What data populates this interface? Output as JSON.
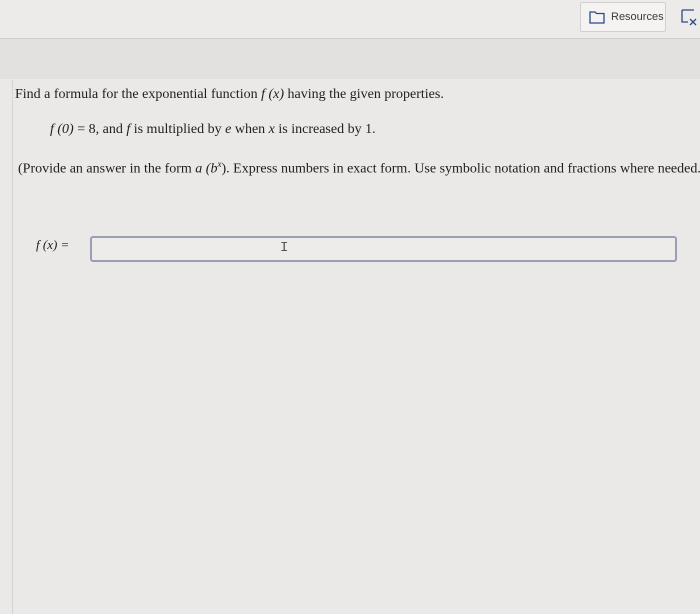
{
  "toolbar": {
    "resources_label": "Resources",
    "resources_icon": "folder-icon",
    "clear_icon": "clear-format-icon"
  },
  "question": {
    "intro_before": "Find a formula for the exponential function ",
    "intro_fx": "f (x)",
    "intro_after": " having the given properties.",
    "cond_f0": "f (0)",
    "cond_mid": " = 8, and ",
    "cond_f": "f",
    "cond_mid2": " is multiplied by ",
    "cond_e": "e",
    "cond_mid3": " when ",
    "cond_x": "x",
    "cond_end": " is increased by 1.",
    "instr_before": "(Provide an answer in the form ",
    "instr_form": "a (b",
    "instr_sup": "x",
    "instr_form_end": ")",
    "instr_after": ". Express numbers in exact form. Use symbolic notation and fractions where needed.)"
  },
  "answer": {
    "label": "f (x) =",
    "value": ""
  }
}
